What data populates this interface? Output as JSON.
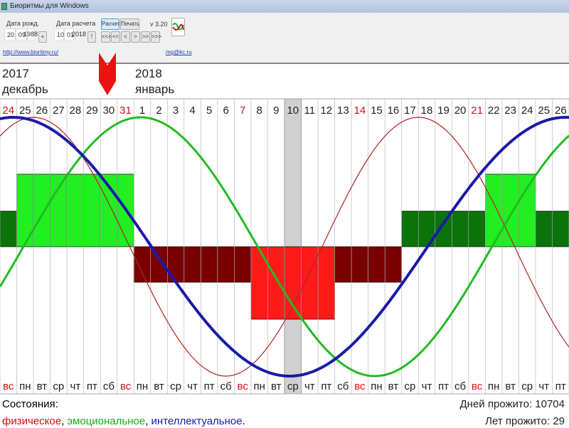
{
  "window": {
    "title": "Биоритмы для Windows"
  },
  "toolbar": {
    "birth_label": "Дата рожд.",
    "birth": [
      "20",
      "09",
      "1988"
    ],
    "calc_label": "Дата расчета",
    "calc": [
      "10",
      "01",
      "2018"
    ],
    "plus_btn": "+",
    "today_btn": "!",
    "calc_btn": "Расчет",
    "print_btn": "Печать",
    "version": "v 3.20",
    "nav": [
      "<<<",
      "<<",
      "<",
      ">",
      ">>",
      ">>>"
    ],
    "site_link": "http://www.bioritmy.ru/",
    "email_link": "mg@kc.ru"
  },
  "header": {
    "year_left": "2017",
    "month_left": "декабрь",
    "year_right": "2018",
    "month_right": "январь"
  },
  "dates": [
    "24",
    "25",
    "26",
    "27",
    "28",
    "29",
    "30",
    "31",
    "1",
    "2",
    "3",
    "4",
    "5",
    "6",
    "7",
    "8",
    "9",
    "10",
    "11",
    "12",
    "13",
    "14",
    "15",
    "16",
    "17",
    "18",
    "19",
    "20",
    "21",
    "22",
    "23",
    "24",
    "25",
    "26"
  ],
  "weekdays": [
    "вс",
    "пн",
    "вт",
    "ср",
    "чт",
    "пт",
    "сб",
    "вс",
    "пн",
    "вт",
    "ср",
    "чт",
    "пт",
    "сб",
    "вс",
    "пн",
    "вт",
    "ср",
    "чт",
    "пт",
    "сб",
    "вс",
    "пн",
    "вт",
    "ср",
    "чт",
    "пт",
    "сб",
    "вс",
    "пн",
    "вт",
    "ср",
    "чт",
    "пт"
  ],
  "selected_index": 17,
  "levels": [
    1,
    2,
    2,
    2,
    2,
    2,
    2,
    2,
    -1,
    -1,
    -1,
    -1,
    -1,
    -1,
    -1,
    -2,
    -2,
    -2,
    -2,
    -2,
    -1,
    -1,
    -1,
    -1,
    1,
    1,
    1,
    1,
    1,
    2,
    2,
    2,
    1,
    1
  ],
  "curves": {
    "physical": {
      "period": 23,
      "peak_index": 1.5,
      "color": "#b22222"
    },
    "emotional": {
      "period": 28,
      "peak_index": 7.9,
      "color": "#22bb22"
    },
    "intellectual": {
      "period": 33,
      "peak_index": 0.3,
      "color": "#1a1aaa"
    }
  },
  "colors": {
    "up2": "#22ee22",
    "up1": "#0a730a",
    "down1": "#7a0000",
    "down2": "#ff1a1a",
    "sunday": "#dd1111"
  },
  "footer": {
    "states_label": "Состояния:",
    "physical": "физическое",
    "emotional": "эмоциональное",
    "intellectual": "интеллектуальное",
    "sep": ", ",
    "end": ".",
    "days_lived": "Дней прожито: 10704",
    "years_lived": "Лет прожито: 29"
  }
}
